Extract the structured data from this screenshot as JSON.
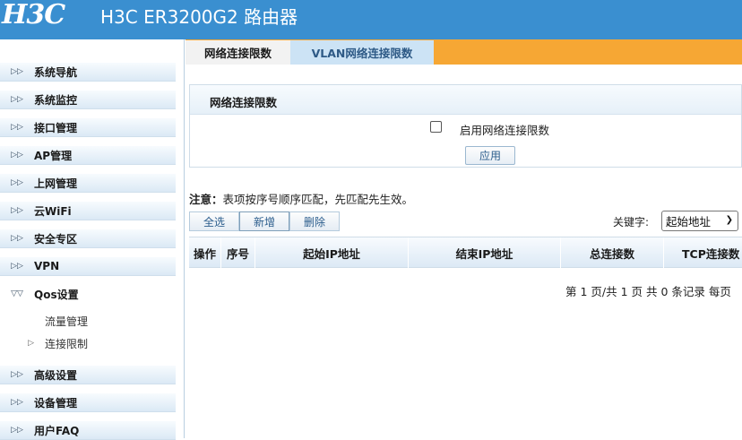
{
  "header": {
    "logo": "H3C",
    "title": "H3C ER3200G2 路由器"
  },
  "sidebar": {
    "items": [
      {
        "label": "系统导航"
      },
      {
        "label": "系统监控"
      },
      {
        "label": "接口管理"
      },
      {
        "label": "AP管理"
      },
      {
        "label": "上网管理"
      },
      {
        "label": "云WiFi"
      },
      {
        "label": "安全专区"
      },
      {
        "label": "VPN"
      },
      {
        "label": "Qos设置"
      },
      {
        "label": "高级设置"
      },
      {
        "label": "设备管理"
      },
      {
        "label": "用户FAQ"
      }
    ],
    "qos_sub": [
      {
        "label": "流量管理"
      },
      {
        "label": "连接限制"
      }
    ]
  },
  "tabs": [
    {
      "label": "网络连接限数"
    },
    {
      "label": "VLAN网络连接限数"
    }
  ],
  "panel": {
    "title": "网络连接限数",
    "enable_label": "启用网络连接限数",
    "apply_label": "应用"
  },
  "note": {
    "prefix": "注意：",
    "text": "表项按序号顺序匹配，先匹配先生效。"
  },
  "toolbar": {
    "select_all": "全选",
    "add": "新增",
    "delete": "删除",
    "keyword_label": "关键字:",
    "keyword_value": "起始地址"
  },
  "table": {
    "columns": [
      "操作",
      "序号",
      "起始IP地址",
      "结束IP地址",
      "总连接数",
      "TCP连接数"
    ]
  },
  "pager": {
    "text": "第 1 页/共 1 页 共 0 条记录 每页"
  }
}
